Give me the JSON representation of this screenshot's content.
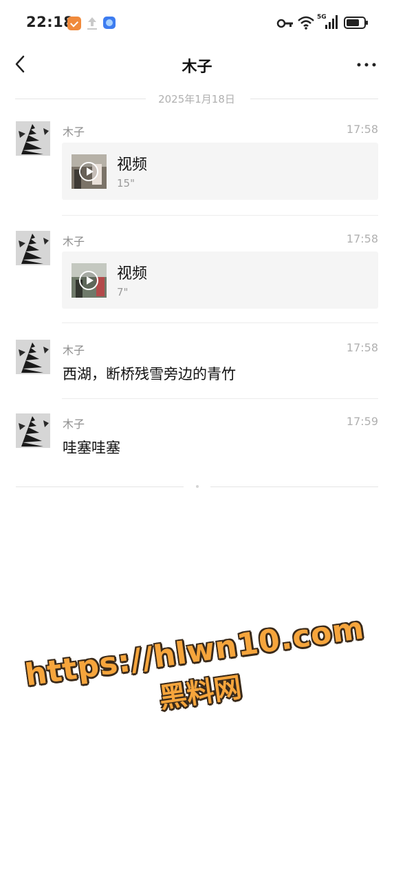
{
  "status_bar": {
    "time": "22:18",
    "network": "5G"
  },
  "header": {
    "title": "木子",
    "back_icon": "chevron-left-icon",
    "more_icon": "more-horizontal-icon"
  },
  "date_separator": "2025年1月18日",
  "messages": [
    {
      "sender": "木子",
      "time": "17:58",
      "type": "video",
      "label": "视频",
      "duration": "15\""
    },
    {
      "sender": "木子",
      "time": "17:58",
      "type": "video",
      "label": "视频",
      "duration": "7\""
    },
    {
      "sender": "木子",
      "time": "17:58",
      "type": "text",
      "text": "西湖，断桥残雪旁边的青竹"
    },
    {
      "sender": "木子",
      "time": "17:59",
      "type": "text",
      "text": "哇塞哇塞"
    }
  ],
  "watermark": {
    "line1": "https://hlwn10.com",
    "line2": "黑料网"
  },
  "colors": {
    "background": "#ffffff",
    "card": "#f5f5f5",
    "watermark": "#f6a53c"
  }
}
